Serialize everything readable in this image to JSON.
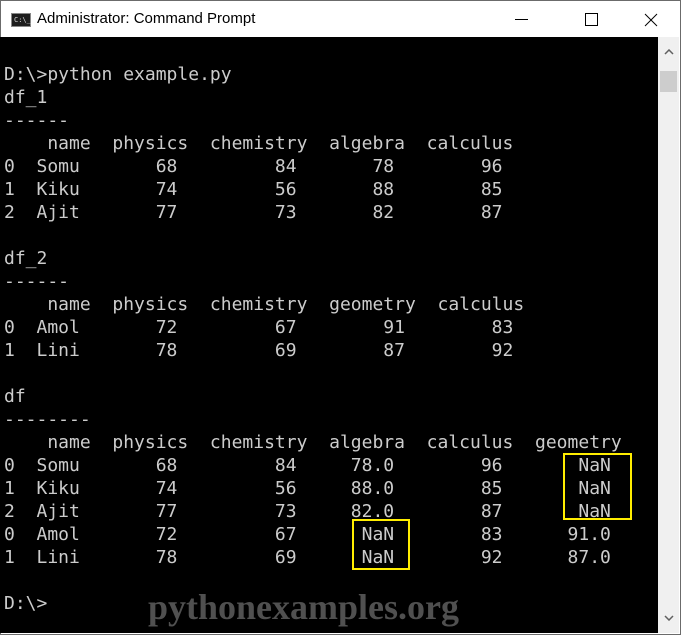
{
  "window": {
    "title": "Administrator: Command Prompt",
    "icon": "cmd-icon",
    "controls": {
      "minimize": "minimize-icon",
      "maximize": "maximize-icon",
      "close": "close-icon"
    }
  },
  "console": {
    "lines": [
      "D:\\>python example.py",
      "df_1",
      "------",
      "    name  physics  chemistry  algebra  calculus",
      "0  Somu       68         84       78        96",
      "1  Kiku       74         56       88        85",
      "2  Ajit       77         73       82        87",
      "",
      "df_2",
      "------",
      "    name  physics  chemistry  geometry  calculus",
      "0  Amol       72         67        91        83",
      "1  Lini       78         69        87        92",
      "",
      "df",
      "--------",
      "    name  physics  chemistry  algebra  calculus  geometry",
      "0  Somu       68         84     78.0        96       NaN",
      "1  Kiku       74         56     88.0        85       NaN",
      "2  Ajit       77         73     82.0        87       NaN",
      "0  Amol       72         67      NaN        83      91.0",
      "1  Lini       78         69      NaN        92      87.0",
      "",
      "D:\\>"
    ]
  },
  "tables": {
    "df_1": {
      "columns": [
        "name",
        "physics",
        "chemistry",
        "algebra",
        "calculus"
      ],
      "index": [
        "0",
        "1",
        "2"
      ],
      "rows": [
        [
          "Somu",
          "68",
          "84",
          "78",
          "96"
        ],
        [
          "Kiku",
          "74",
          "56",
          "88",
          "85"
        ],
        [
          "Ajit",
          "77",
          "73",
          "82",
          "87"
        ]
      ]
    },
    "df_2": {
      "columns": [
        "name",
        "physics",
        "chemistry",
        "geometry",
        "calculus"
      ],
      "index": [
        "0",
        "1"
      ],
      "rows": [
        [
          "Amol",
          "72",
          "67",
          "91",
          "83"
        ],
        [
          "Lini",
          "78",
          "69",
          "87",
          "92"
        ]
      ]
    },
    "df": {
      "columns": [
        "name",
        "physics",
        "chemistry",
        "algebra",
        "calculus",
        "geometry"
      ],
      "index": [
        "0",
        "1",
        "2",
        "0",
        "1"
      ],
      "rows": [
        [
          "Somu",
          "68",
          "84",
          "78.0",
          "96",
          "NaN"
        ],
        [
          "Kiku",
          "74",
          "56",
          "88.0",
          "85",
          "NaN"
        ],
        [
          "Ajit",
          "77",
          "73",
          "82.0",
          "87",
          "NaN"
        ],
        [
          "Amol",
          "72",
          "67",
          "NaN",
          "83",
          "91.0"
        ],
        [
          "Lini",
          "78",
          "69",
          "NaN",
          "92",
          "87.0"
        ]
      ]
    }
  },
  "highlights": {
    "color": "#ffed00",
    "items": [
      "geometry NaN (rows 0-2)",
      "algebra NaN (rows 3-4)"
    ]
  },
  "watermark": "pythonexamples.org",
  "colors": {
    "console_bg": "#000000",
    "console_text": "#cccccc",
    "titlebar_bg": "#ffffff",
    "scrollbar_bg": "#f0f0f0"
  }
}
